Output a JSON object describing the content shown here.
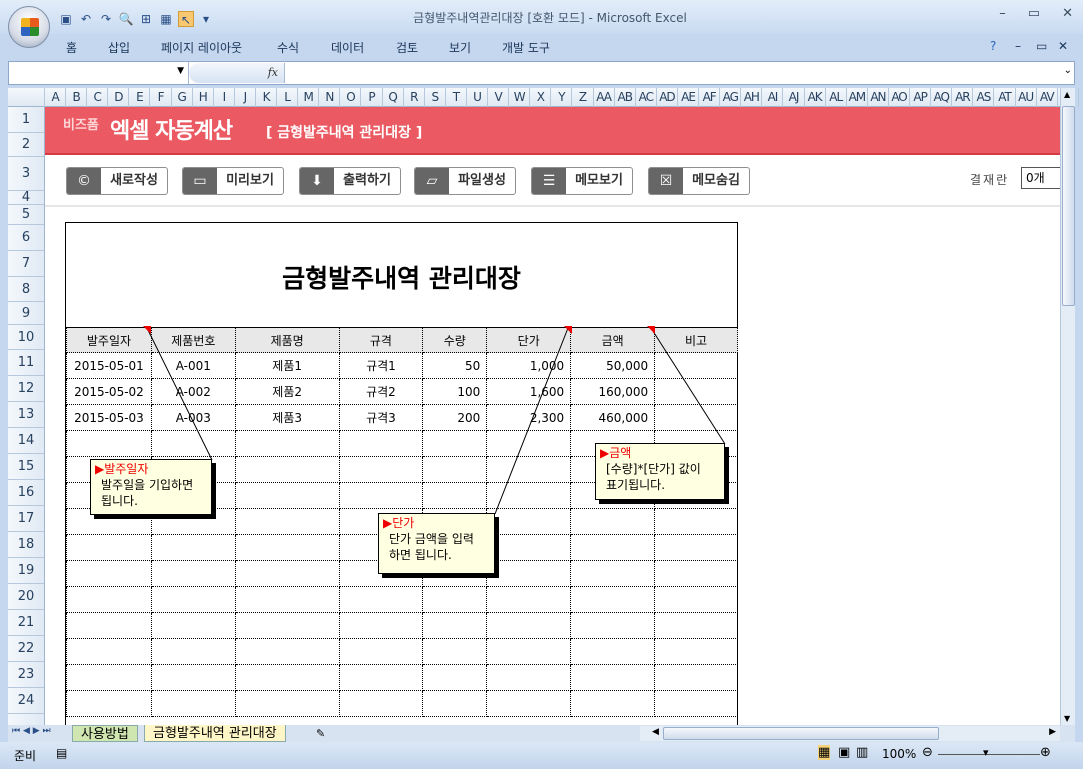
{
  "window": {
    "title": "금형발주내역관리대장  [호환 모드] - Microsoft Excel",
    "controls": [
      "–",
      "▭",
      "✕"
    ]
  },
  "ribbon_tabs": [
    "홈",
    "삽입",
    "페이지 레이아웃",
    "수식",
    "데이터",
    "검토",
    "보기",
    "개발 도구"
  ],
  "formula": {
    "fx": "fx",
    "name_box": ""
  },
  "columns": [
    "A",
    "B",
    "C",
    "D",
    "E",
    "F",
    "G",
    "H",
    "I",
    "J",
    "K",
    "L",
    "M",
    "N",
    "O",
    "P",
    "Q",
    "R",
    "S",
    "T",
    "U",
    "V",
    "W",
    "X",
    "Y",
    "Z",
    "AA",
    "AB",
    "AC",
    "AD",
    "AE",
    "AF",
    "AG",
    "AH",
    "AI",
    "AJ",
    "AK",
    "AL",
    "AM",
    "AN",
    "AO",
    "AP",
    "AQ",
    "AR",
    "AS",
    "AT",
    "AU",
    "AV",
    "A"
  ],
  "rows": [
    "1",
    "2",
    "3",
    "4",
    "5",
    "6",
    "7",
    "8",
    "9",
    "10",
    "11",
    "12",
    "13",
    "14",
    "15",
    "16",
    "17",
    "18",
    "19",
    "20",
    "21",
    "22",
    "23",
    "24"
  ],
  "banner": {
    "brand_small": "비즈폼",
    "brand_big": "엑셀 자동계산",
    "subtitle": "[ 금형발주내역 관리대장 ]"
  },
  "buttons": [
    {
      "label": "새로작성",
      "icon": "new-doc-icon"
    },
    {
      "label": "미리보기",
      "icon": "monitor-icon"
    },
    {
      "label": "출력하기",
      "icon": "print-icon"
    },
    {
      "label": "파일생성",
      "icon": "folder-icon"
    },
    {
      "label": "메모보기",
      "icon": "memo-show-icon"
    },
    {
      "label": "메모숨김",
      "icon": "memo-hide-icon"
    }
  ],
  "approval": {
    "label": "결재란",
    "value": "0개"
  },
  "document": {
    "title": "금형발주내역 관리대장",
    "headers": [
      "발주일자",
      "제품번호",
      "제품명",
      "규격",
      "수량",
      "단가",
      "금액",
      "비고"
    ],
    "rows": [
      [
        "2015-05-01",
        "A-001",
        "제품1",
        "규격1",
        "50",
        "1,000",
        "50,000",
        ""
      ],
      [
        "2015-05-02",
        "A-002",
        "제품2",
        "규격2",
        "100",
        "1,600",
        "160,000",
        ""
      ],
      [
        "2015-05-03",
        "A-003",
        "제품3",
        "규격3",
        "200",
        "2,300",
        "460,000",
        ""
      ]
    ]
  },
  "memos": [
    {
      "title": "▶발주일자",
      "body": "발주일을 기입하면\n됩니다."
    },
    {
      "title": "▶단가",
      "body": "단가 금액을 입력\n하면 됩니다."
    },
    {
      "title": "▶금액",
      "body": "[수량]*[단가] 값이\n표기됩니다."
    }
  ],
  "sheet_tabs": [
    "사용방법",
    "금형발주내역 관리대장"
  ],
  "status": {
    "ready": "준비",
    "zoom": "100%"
  },
  "colors": {
    "banner": "#eb5a62",
    "memo": "#ffffe1",
    "active_tab": "#fff6c8",
    "first_tab": "#cfe6b0"
  }
}
